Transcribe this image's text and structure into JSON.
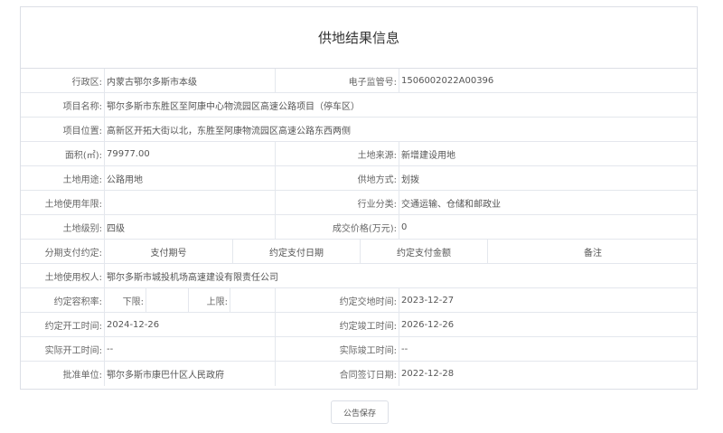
{
  "page": {
    "title": "供地结果信息"
  },
  "fields": {
    "district_label": "行政区:",
    "district_value": "内蒙古鄂尔多斯市本级",
    "supervision_no_label": "电子监管号:",
    "supervision_no_value": "1506002022A00396",
    "project_name_label": "项目名称:",
    "project_name_value": "鄂尔多斯市东胜区至阿康中心物流园区高速公路项目（停车区）",
    "project_location_label": "项目位置:",
    "project_location_value": "高新区开拓大街以北，东胜至阿康物流园区高速公路东西两侧",
    "area_label": "面积(㎡):",
    "area_value": "79977.00",
    "land_source_label": "土地来源:",
    "land_source_value": "新增建设用地",
    "land_use_label": "土地用途:",
    "land_use_value": "公路用地",
    "supply_method_label": "供地方式:",
    "supply_method_value": "划拨",
    "use_term_label": "土地使用年限:",
    "use_term_value": "",
    "industry_label": "行业分类:",
    "industry_value": "交通运输、仓储和邮政业",
    "land_grade_label": "土地级别:",
    "land_grade_value": "四级",
    "deal_price_label": "成交价格(万元):",
    "deal_price_value": "0",
    "installment_label": "分期支付约定:",
    "installment_headers": [
      "支付期号",
      "约定支付日期",
      "约定支付金额",
      "备注"
    ],
    "land_user_label": "土地使用权人:",
    "land_user_value": "鄂尔多斯市城投机场高速建设有限责任公司",
    "plot_ratio_label": "约定容积率:",
    "lower_limit_label": "下限:",
    "lower_limit_value": "",
    "upper_limit_label": "上限:",
    "upper_limit_value": "",
    "handover_label": "约定交地时间:",
    "handover_value": "2023-12-27",
    "start_label": "约定开工时间:",
    "start_value": "2024-12-26",
    "complete_label": "约定竣工时间:",
    "complete_value": "2026-12-26",
    "actual_start_label": "实际开工时间:",
    "actual_start_value": "--",
    "actual_complete_label": "实际竣工时间:",
    "actual_complete_value": "--",
    "approver_label": "批准单位:",
    "approver_value": "鄂尔多斯市康巴什区人民政府",
    "contract_date_label": "合同签订日期:",
    "contract_date_value": "2022-12-28"
  },
  "actions": {
    "save_label": "公告保存"
  }
}
